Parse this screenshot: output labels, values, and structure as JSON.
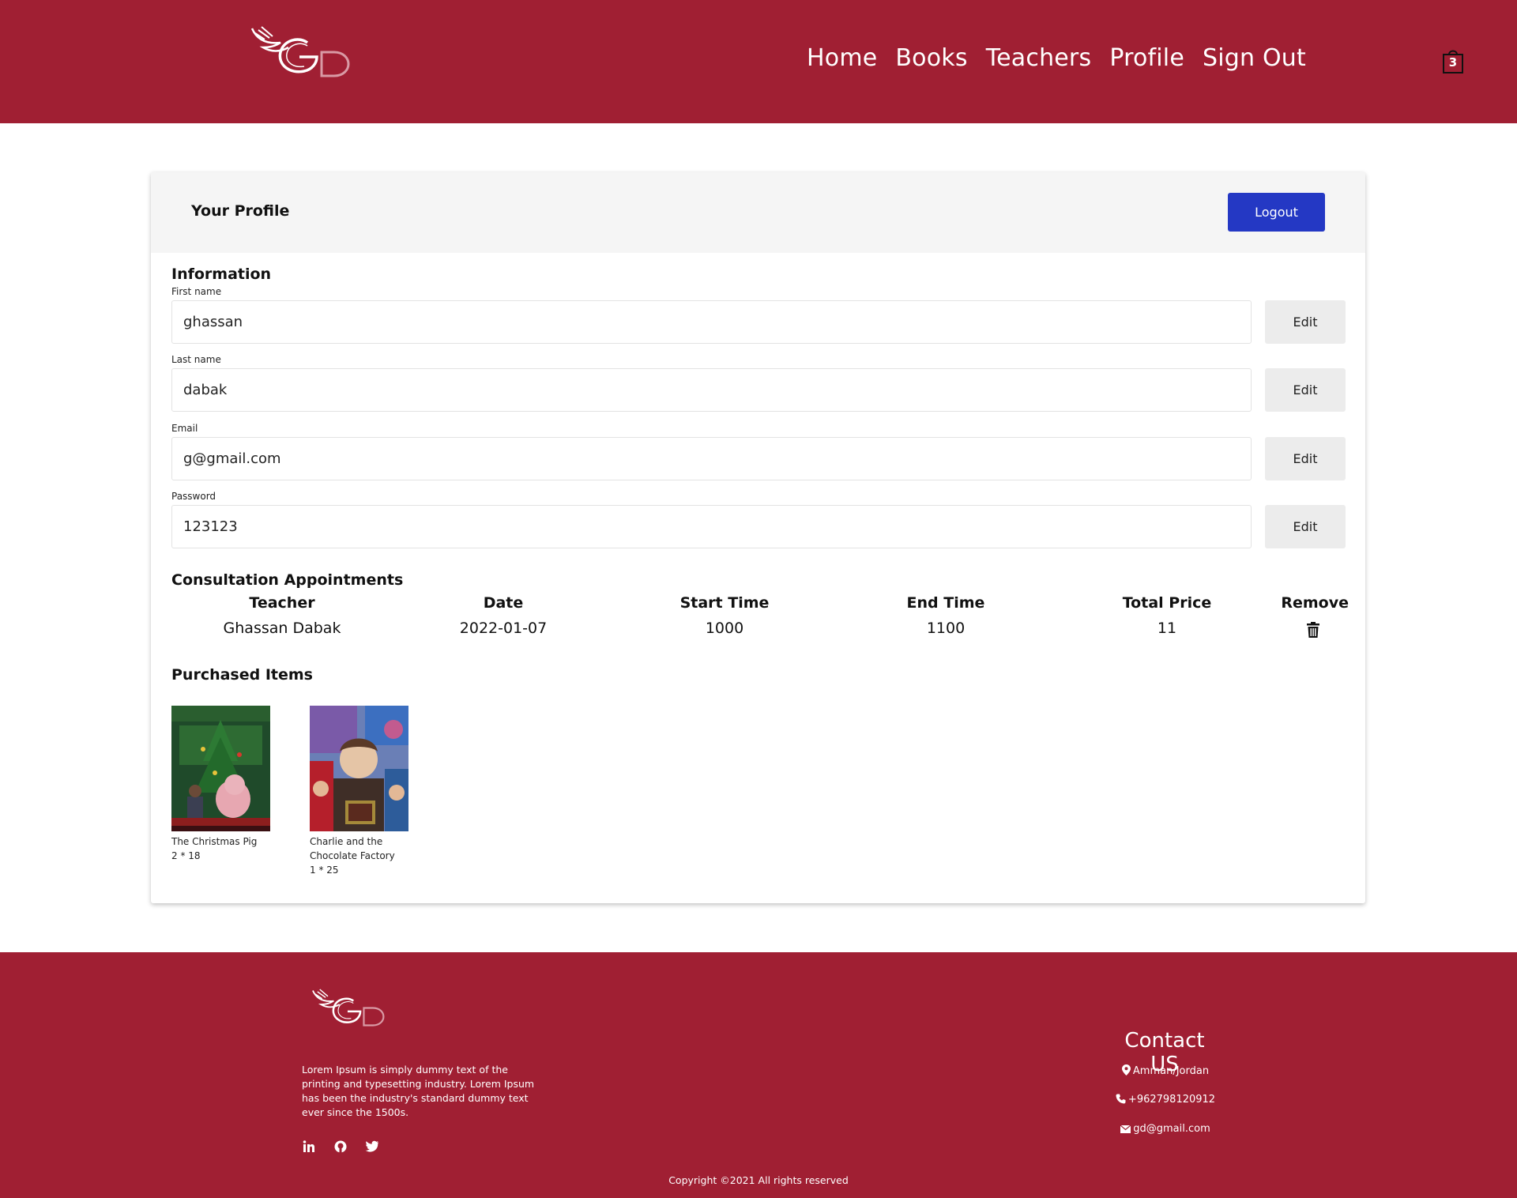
{
  "header": {
    "logo_icon": "gd-wing-logo",
    "nav": [
      "Home",
      "Books",
      "Teachers",
      "Profile",
      "Sign Out"
    ],
    "cart_icon": "shopping-bag-icon",
    "cart_count": "3"
  },
  "profile": {
    "title": "Your Profile",
    "logout_label": "Logout",
    "info_title": "Information",
    "fields": [
      {
        "label": "First name",
        "value": "ghassan",
        "edit_label": "Edit"
      },
      {
        "label": "Last name",
        "value": "dabak",
        "edit_label": "Edit"
      },
      {
        "label": "Email",
        "value": "g@gmail.com",
        "edit_label": "Edit"
      },
      {
        "label": "Password",
        "value": "123123",
        "edit_label": "Edit"
      }
    ]
  },
  "appointments": {
    "title": "Consultation Appointments",
    "headers": [
      "Teacher",
      "Date",
      "Start Time",
      "End Time",
      "Total Price",
      "Remove"
    ],
    "rows": [
      {
        "teacher": "Ghassan Dabak",
        "date": "2022-01-07",
        "start": "1000",
        "end": "1100",
        "price": "11",
        "remove_icon": "trash-icon"
      }
    ]
  },
  "purchased": {
    "title": "Purchased Items",
    "items": [
      {
        "title": "The Christmas Pig",
        "qty": "2 * 18"
      },
      {
        "title": "Charlie and the Chocolate Factory",
        "qty": "1 * 25"
      }
    ]
  },
  "footer": {
    "description": "Lorem Ipsum is simply dummy text of the printing and typesetting industry. Lorem Ipsum has been the industry's standard dummy text ever since the 1500s.",
    "socials": [
      "linkedin-icon",
      "github-icon",
      "twitter-icon"
    ],
    "contact_title": "Contact US",
    "location": "Amman/Jordan",
    "phone": "+962798120912",
    "email": "gd@gmail.com",
    "copyright": "Copyright ©2021 All rights reserved"
  },
  "colors": {
    "brand": "#a01f33",
    "logout_button": "#2438c4"
  }
}
